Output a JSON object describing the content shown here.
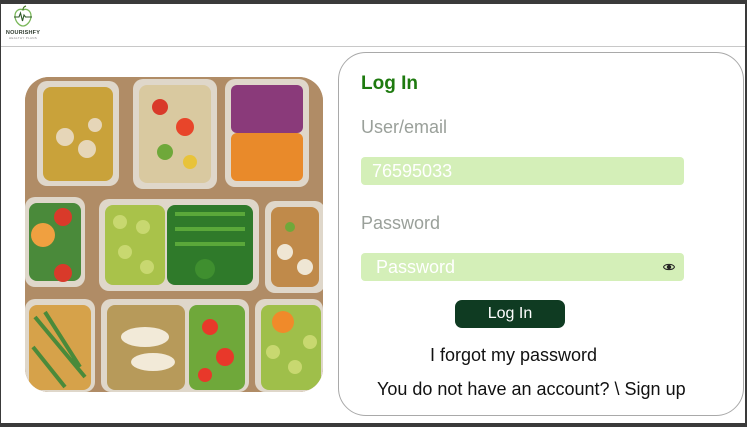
{
  "brand": {
    "name": "NOURISHFY",
    "tagline": "HEALTHY PLANS"
  },
  "photo": {
    "description_icon": "meal-prep-photo"
  },
  "login": {
    "title": "Log In",
    "user_label": "User/email",
    "user_value": "76595033",
    "password_label": "Password",
    "password_value": "Password",
    "submit_label": "Log In",
    "forgot_link": "I forgot my password",
    "signup_text": "You do not have an account? \\ Sign up"
  },
  "colors": {
    "accent_green": "#1e7a0f",
    "field_bg": "#d4efb8",
    "button_bg": "#0f3b22"
  }
}
